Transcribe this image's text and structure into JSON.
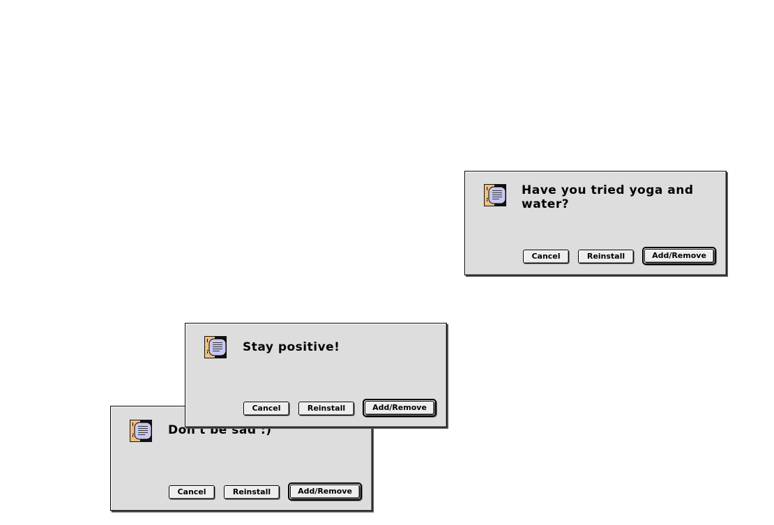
{
  "dialogs": [
    {
      "message": "Don't be sad :)",
      "buttons": {
        "cancel": "Cancel",
        "reinstall": "Reinstall",
        "add_remove": "Add/Remove"
      },
      "icon": "extensions-manager-icon"
    },
    {
      "message": "Stay positive!",
      "buttons": {
        "cancel": "Cancel",
        "reinstall": "Reinstall",
        "add_remove": "Add/Remove"
      },
      "icon": "extensions-manager-icon"
    },
    {
      "message": "Have you tried yoga and water?",
      "buttons": {
        "cancel": "Cancel",
        "reinstall": "Reinstall",
        "add_remove": "Add/Remove"
      },
      "icon": "extensions-manager-icon"
    }
  ],
  "colors": {
    "dialog_bg": "#dddddd",
    "button_bg": "#eeeeee",
    "icon_face": "#f0c080",
    "icon_bubble": "#c8c8f0"
  }
}
